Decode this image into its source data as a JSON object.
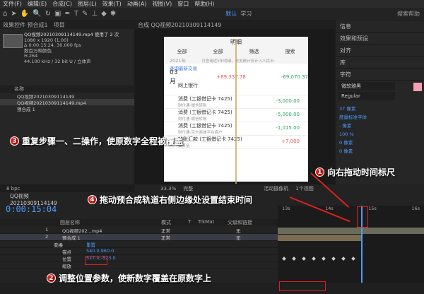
{
  "menu": [
    "文件(F)",
    "编辑(E)",
    "合成(C)",
    "图层(L)",
    "效果(T)",
    "动画(A)",
    "视图(V)",
    "窗口",
    "帮助(H)"
  ],
  "toolbar": {
    "workspace": "默认",
    "workspace2": "学习",
    "search": "搜索帮助"
  },
  "project": {
    "tab1": "效果控件 预合成1",
    "tab2": "项目",
    "item_name": "QQ视频20210309114149.mp4",
    "used": "使用了 2 次",
    "info_lines": [
      "1080 x 1920 (1.00)",
      "Δ 0:00:15:24, 30.000 fps",
      "数百万种颜色",
      "H.264",
      "44.100 kHz / 32 bit U / 立体声"
    ],
    "list_header": "名称",
    "rows": [
      "QQ视频20210309114149",
      "QQ视频20210309114149.mp4",
      "预合成 1"
    ]
  },
  "viewer": {
    "tab": "合成 QQ视频20210309114149",
    "zoom": "33.3%",
    "phone": {
      "title": "明细",
      "filters": [
        "全部",
        "全部",
        "筛选",
        "搜索"
      ],
      "year": "2021年",
      "notice": "可查询近5年明细，收支统计仅计入人民币",
      "link": "查询最新交易",
      "month": "03月",
      "month_in": "+89,337.78",
      "month_out": "-69,070.37",
      "rows": [
        {
          "title": "网上银行",
          "sub": "",
          "amt": "",
          "neg": false
        },
        {
          "title": "消费 (工银借记卡 7425)",
          "sub": "财付通-微信转账",
          "amt": "-3,000.00",
          "neg": false
        },
        {
          "title": "消费 (工银借记卡 7425)",
          "sub": "财付通-微信转账",
          "amt": "-5,000.00",
          "neg": false
        },
        {
          "title": "消费 (工银借记卡 7425)",
          "sub": "财付通-京东商城平台商户",
          "amt": "-1,015.00",
          "neg": false
        },
        {
          "title": "转账汇款 (工银借记卡 7425)",
          "sub": "黄某金",
          "amt": "+7,000",
          "neg": true
        }
      ]
    }
  },
  "rightpanel": {
    "items": [
      "信息",
      "效果和预设",
      "对齐",
      "库",
      "字符"
    ],
    "font": "微软雅黑",
    "style": "Regular",
    "values": [
      "37 像素",
      "度量标准字体",
      "- 像素",
      "100 %",
      "0 像素",
      "0 像素"
    ]
  },
  "viewer_bar": {
    "res": "完整",
    "camera": "活动摄像机",
    "view": "1个视图"
  },
  "timeline": {
    "tab": "QQ视频20210309114149",
    "timecode": "0:00:15:04",
    "columns": [
      "图层名称",
      "模式",
      "T",
      "TrkMat",
      "父级和链接"
    ],
    "layers": [
      {
        "idx": "1",
        "name": "QQ视频202...mp4",
        "mode": "正常",
        "parent": "无"
      },
      {
        "idx": "2",
        "name": "预合成 1",
        "mode": "正常",
        "parent": "无"
      }
    ],
    "props": [
      "变换",
      "锚点",
      "位置",
      "缩放"
    ],
    "anchor_val": "540.0,960.0",
    "position_val": "527.0,-523.0",
    "ruler": [
      "13s",
      "14s",
      "15s",
      "16s"
    ],
    "extra": "重置",
    "fps": "8 bpc"
  },
  "callouts": {
    "c1": "向右拖动时间标尺",
    "c2": "调整位置参数，使新数字覆盖在原数字上",
    "c3": "重复步骤一、二操作，使原数字全程被覆盖",
    "c4": "拖动预合成轨道右侧边缘处设置结束时间"
  },
  "colors": {
    "accent": "#4a9cff",
    "callout": "#e0201b",
    "positive": "#2aa366"
  }
}
